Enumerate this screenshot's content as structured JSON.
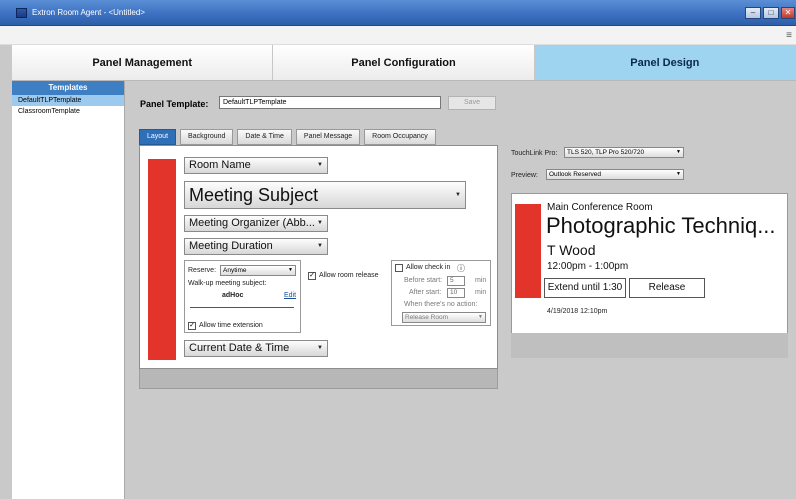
{
  "window": {
    "title": "Extron Room Agent - <Untitled>",
    "minimize_glyph": "–",
    "maximize_glyph": "□",
    "close_glyph": "✕"
  },
  "menu_icon": "≡",
  "nav": {
    "tabs": [
      {
        "label": "Panel Management"
      },
      {
        "label": "Panel Configuration"
      },
      {
        "label": "Panel Design"
      }
    ]
  },
  "sidebar": {
    "header": "Templates",
    "items": [
      {
        "label": "DefaultTLPTemplate"
      },
      {
        "label": "ClassroomTemplate"
      }
    ]
  },
  "panel_template": {
    "label": "Panel Template:",
    "value": "DefaultTLPTemplate",
    "save_label": "Save"
  },
  "tabs": [
    {
      "label": "Layout"
    },
    {
      "label": "Background"
    },
    {
      "label": "Date & Time"
    },
    {
      "label": "Panel Message"
    },
    {
      "label": "Room Occupancy"
    }
  ],
  "layout": {
    "room_name": "Room Name",
    "meeting_subject": "Meeting Subject",
    "meeting_organizer": "Meeting Organizer (Abb...",
    "meeting_duration": "Meeting Duration",
    "current_datetime": "Current Date & Time",
    "reserve_label": "Reserve:",
    "reserve_value": "Anytime",
    "walkup_label": "Walk-up meeting subject:",
    "walkup_value": "adHoc",
    "edit_label": "Edit",
    "allow_room_release": "Allow room release",
    "allow_time_extension": "Allow time extension",
    "allow_check_in": "Allow check in",
    "before_start_label": "Before start:",
    "before_start_value": "5",
    "after_start_label": "After start:",
    "after_start_value": "10",
    "min_unit": "min",
    "no_action_label": "When there's no action:",
    "no_action_value": "Release Room"
  },
  "right": {
    "touchlink_label": "TouchLink Pro:",
    "touchlink_value": "TLS 520, TLP Pro 520/720",
    "preview_label": "Preview:",
    "preview_value": "Outlook Reserved"
  },
  "preview": {
    "room": "Main Conference Room",
    "subject": "Photographic Techniq...",
    "organizer": "T Wood",
    "time": "12:00pm - 1:00pm",
    "extend_label": "Extend until 1:30",
    "release_label": "Release",
    "datetime": "4/19/2018  12:10pm"
  },
  "colors": {
    "accent_blue": "#2f6fb8",
    "active_nav": "#9fd4f0",
    "red_block": "#e3342b"
  }
}
